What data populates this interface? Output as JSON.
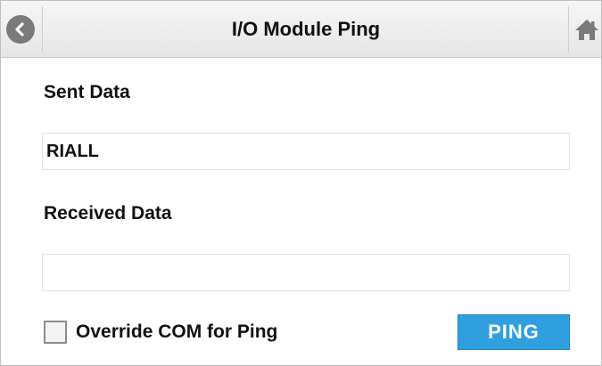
{
  "header": {
    "title": "I/O Module Ping",
    "back_icon": "back-arrow-icon",
    "home_icon": "home-icon"
  },
  "sent": {
    "label": "Sent Data",
    "value": "RIALL"
  },
  "received": {
    "label": "Received Data",
    "value": ""
  },
  "override": {
    "label": "Override COM for Ping",
    "checked": false
  },
  "actions": {
    "ping_label": "PING"
  },
  "colors": {
    "accent": "#2f9fe0",
    "icon_gray": "#7a7a7a"
  }
}
